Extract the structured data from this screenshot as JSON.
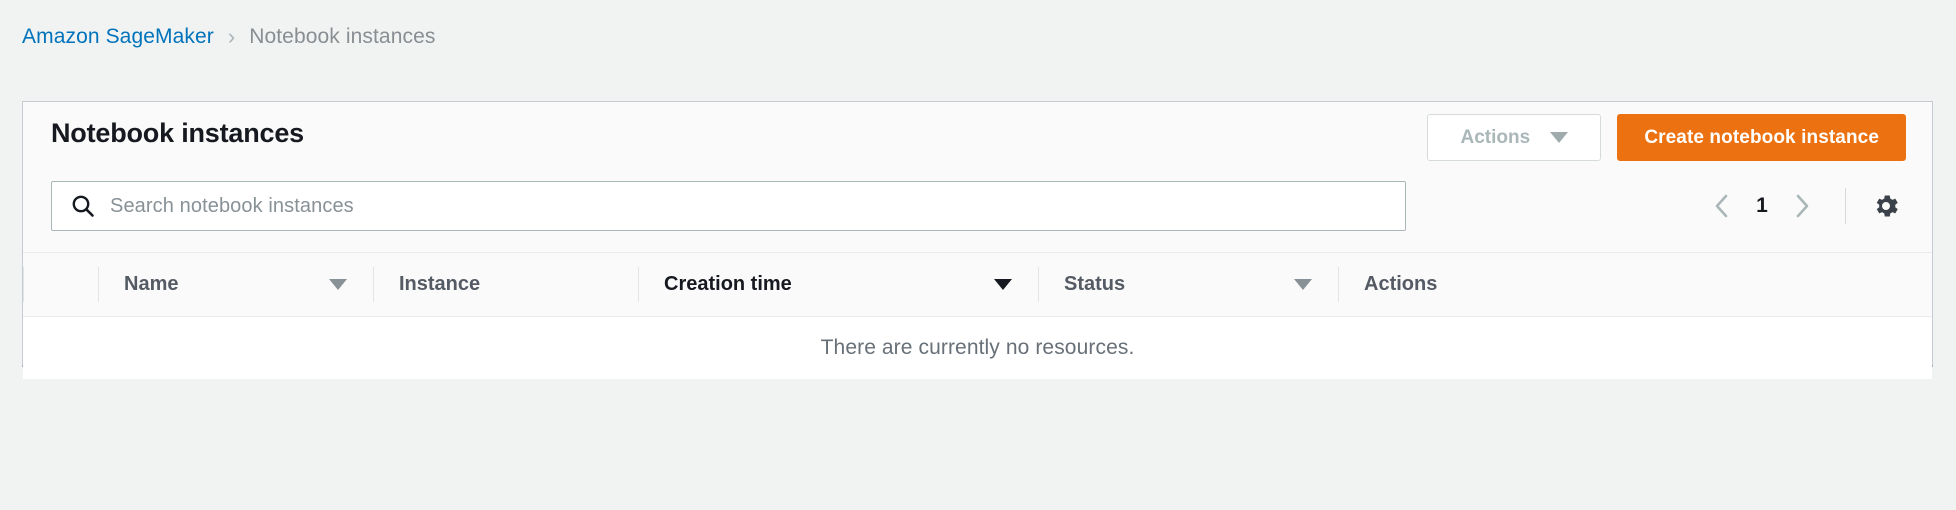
{
  "breadcrumb": {
    "root_label": "Amazon SageMaker",
    "separator": "›",
    "current_label": "Notebook instances"
  },
  "panel": {
    "title": "Notebook instances",
    "actions_button": {
      "label": "Actions",
      "icon": "chevron-down-icon",
      "disabled": true
    },
    "create_button": {
      "label": "Create notebook instance",
      "color": "#ec7211"
    }
  },
  "search": {
    "placeholder": "Search notebook instances",
    "value": "",
    "icon": "search-icon"
  },
  "pagination": {
    "prev_icon": "chevron-left-icon",
    "next_icon": "chevron-right-icon",
    "current_page": "1",
    "settings_icon": "gear-icon"
  },
  "table": {
    "columns": [
      {
        "label": "Name",
        "sortable": true,
        "active": false
      },
      {
        "label": "Instance",
        "sortable": false,
        "active": false
      },
      {
        "label": "Creation time",
        "sortable": true,
        "active": true
      },
      {
        "label": "Status",
        "sortable": true,
        "active": false
      },
      {
        "label": "Actions",
        "sortable": false,
        "active": false
      }
    ],
    "empty_message": "There are currently no resources.",
    "rows": []
  },
  "colors": {
    "link": "#0073bb",
    "accent": "#ec7211",
    "page_background": "#f1f3f3",
    "panel_background": "#fafafa",
    "text_primary": "#16191f",
    "text_secondary": "#687078"
  }
}
